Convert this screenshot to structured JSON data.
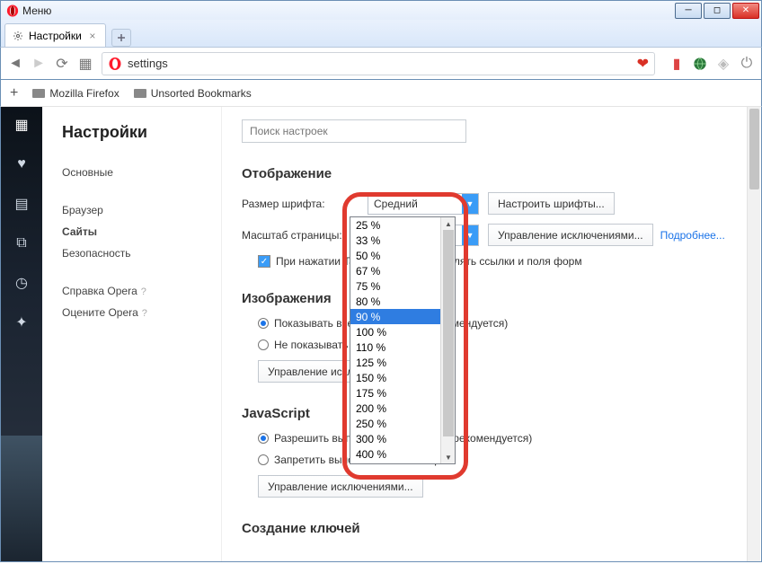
{
  "window": {
    "menu": "Меню"
  },
  "tab": {
    "title": "Настройки"
  },
  "address": {
    "value": "settings"
  },
  "bookmarks": {
    "item1": "Mozilla Firefox",
    "item2": "Unsorted Bookmarks"
  },
  "nav": {
    "title": "Настройки",
    "items": [
      "Основные",
      "Браузер",
      "Сайты",
      "Безопасность"
    ],
    "help": "Справка Opera",
    "rate": "Оцените Opera"
  },
  "search": {
    "placeholder": "Поиск настроек"
  },
  "sections": {
    "display": "Отображение",
    "images": "Изображения",
    "js": "JavaScript",
    "keys": "Создание ключей"
  },
  "display": {
    "font_label": "Размер шрифта:",
    "font_value": "Средний",
    "font_btn": "Настроить шрифты...",
    "zoom_label": "Масштаб страницы:",
    "zoom_value": "90 %",
    "zoom_btn": "Управление исключениями...",
    "zoom_more": "Подробнее...",
    "tab_check": "При нажатии Tab на странице выделять ссылки и поля форм"
  },
  "images": {
    "show": "Показывать все изображения (рекомендуется)",
    "hide": "Не показывать изображения",
    "btn": "Управление исключениями..."
  },
  "js": {
    "allow": "Разрешить выполнение JavaScript (рекомендуется)",
    "deny": "Запретить выполнение JavaScript",
    "btn": "Управление исключениями..."
  },
  "zoom_options": [
    "25 %",
    "33 %",
    "50 %",
    "67 %",
    "75 %",
    "80 %",
    "90 %",
    "100 %",
    "110 %",
    "125 %",
    "150 %",
    "175 %",
    "200 %",
    "250 %",
    "300 %",
    "400 %"
  ],
  "zoom_selected_index": 6
}
